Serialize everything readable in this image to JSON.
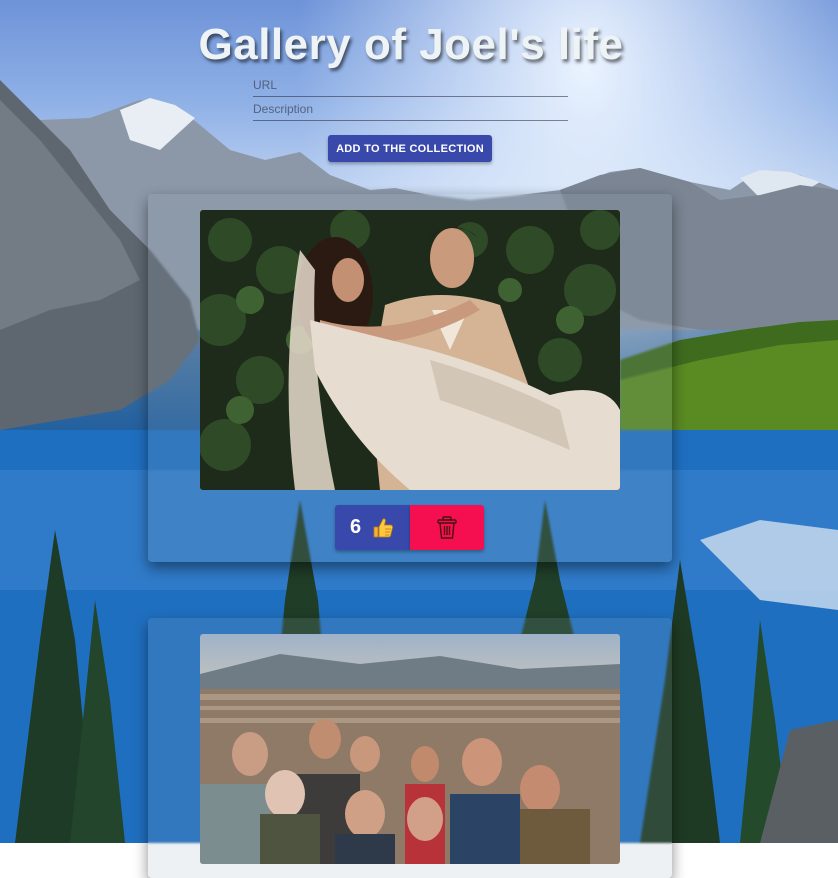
{
  "header": {
    "title": "Gallery of Joel's life"
  },
  "form": {
    "url_placeholder": "URL",
    "description_placeholder": "Description",
    "submit_label": "ADD TO THE COLLECTION"
  },
  "gallery": [
    {
      "likes": "6",
      "like_icon": "thumbs-up-icon",
      "delete_icon": "trash-icon"
    }
  ],
  "colors": {
    "primary": "#3949ab",
    "danger": "#f50f50"
  }
}
